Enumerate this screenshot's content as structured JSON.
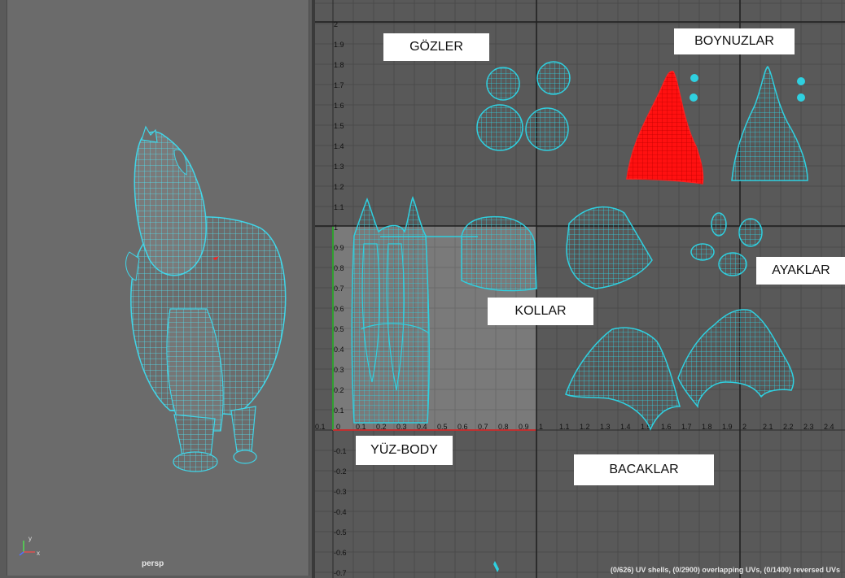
{
  "perspective_view": {
    "camera_label": "persp",
    "axis_labels": {
      "y": "y",
      "x": "x"
    }
  },
  "uv_editor": {
    "status_text": "(0/626) UV shells, (0/2900) overlapping UVs, (0/1400) reversed UVs",
    "region_labels": {
      "eyes": "GÖZLER",
      "horns": "BOYNUZLAR",
      "feet": "AYAKLAR",
      "arms": "KOLLAR",
      "face_body": "YÜZ-BODY",
      "legs": "BACAKLAR"
    },
    "u_ticks": [
      "0.1",
      "0",
      "0.1",
      "0.2",
      "0.3",
      "0.4",
      "0.5",
      "0.6",
      "0.7",
      "0.8",
      "0.9",
      "1",
      "1.1",
      "1.2",
      "1.3",
      "1.4",
      "1.5",
      "1.6",
      "1.7",
      "1.8",
      "1.9",
      "2",
      "2.1",
      "2.2",
      "2.3",
      "2.4"
    ],
    "v_ticks": [
      "2",
      "1.9",
      "1.8",
      "1.7",
      "1.6",
      "1.5",
      "1.4",
      "1.3",
      "1.2",
      "1.1",
      "1",
      "0.9",
      "0.8",
      "0.7",
      "0.6",
      "0.5",
      "0.4",
      "0.3",
      "0.2",
      "0.1",
      "0",
      "-0.1",
      "-0.2",
      "-0.3",
      "-0.4",
      "-0.5",
      "-0.6",
      "-0.7"
    ],
    "colors": {
      "uv_shell": "#2fd0e0",
      "selected_shell": "#ff1010",
      "background": "#595959",
      "grid": "#444444",
      "unit_square": "#7a7a7a"
    }
  }
}
